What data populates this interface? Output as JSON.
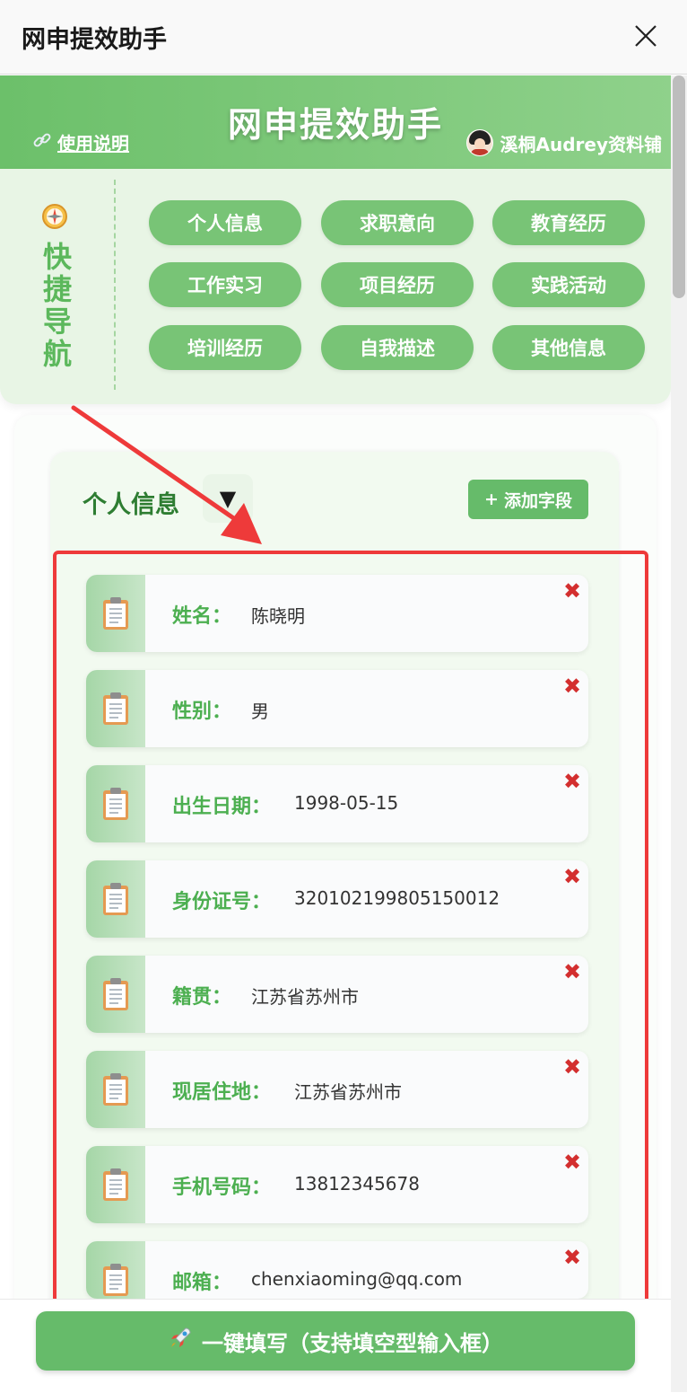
{
  "window": {
    "title": "网申提效助手",
    "close_icon": "close-icon"
  },
  "banner": {
    "title": "网申提效助手",
    "help_link": "使用说明",
    "author": "溪桐Audrey资料铺",
    "colors": {
      "banner": "#6cc06a",
      "accent": "#66bb6a",
      "delete": "#d32f2f",
      "highlight": "#ee3a3a"
    }
  },
  "nav": {
    "label": "快捷导航",
    "items": [
      {
        "label": "个人信息"
      },
      {
        "label": "求职意向"
      },
      {
        "label": "教育经历"
      },
      {
        "label": "工作实习"
      },
      {
        "label": "项目经历"
      },
      {
        "label": "实践活动"
      },
      {
        "label": "培训经历"
      },
      {
        "label": "自我描述"
      },
      {
        "label": "其他信息"
      }
    ]
  },
  "section": {
    "title": "个人信息",
    "toggle": "▼",
    "add_button": "添加字段",
    "add_icon": "+"
  },
  "fields": [
    {
      "label": "姓名：",
      "value": "陈晓明"
    },
    {
      "label": "性别：",
      "value": "男"
    },
    {
      "label": "出生日期：",
      "value": "1998-05-15"
    },
    {
      "label": "身份证号：",
      "value": "320102199805150012"
    },
    {
      "label": "籍贯：",
      "value": "江苏省苏州市"
    },
    {
      "label": "现居住地：",
      "value": "江苏省苏州市"
    },
    {
      "label": "手机号码：",
      "value": "13812345678"
    },
    {
      "label": "邮箱：",
      "value": "chenxiaoming@qq.com"
    }
  ],
  "delete_symbol": "✖",
  "fill_button": {
    "label": "一键填写（支持填空型输入框）",
    "icon": "rocket-icon"
  }
}
